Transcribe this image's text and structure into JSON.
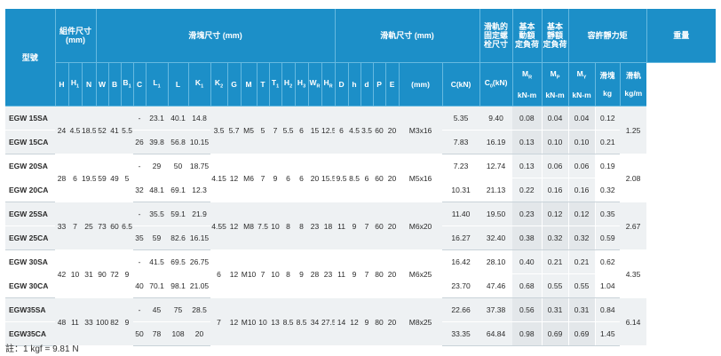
{
  "header": {
    "model": "型號",
    "assembly_dims": "組件尺寸",
    "assembly_unit": "(mm)",
    "block_dims": "滑塊尺寸 (mm)",
    "rail_dims": "滑軌尺寸 (mm)",
    "rail_bolt_line1": "滑軌的",
    "rail_bolt_line2": "固定螺",
    "rail_bolt_line3": "栓尺寸",
    "dyn_line1": "基本",
    "dyn_line2": "動額",
    "dyn_line3": "定負荷",
    "stat_line1": "基本",
    "stat_line2": "靜額",
    "stat_line3": "定負荷",
    "static_moment": "容許靜力矩",
    "weight": "重量",
    "sub": {
      "H": "H",
      "H1": "H",
      "H1_sub": "1",
      "N": "N",
      "W": "W",
      "B": "B",
      "B1": "B",
      "B1_sub": "1",
      "C": "C",
      "L1": "L",
      "L1_sub": "1",
      "L": "L",
      "K1": "K",
      "K1_sub": "1",
      "K2": "K",
      "K2_sub": "2",
      "G": "G",
      "M": "M",
      "T": "T",
      "T1": "T",
      "T1_sub": "1",
      "H2": "H",
      "H2_sub": "2",
      "H3": "H",
      "H3_sub": "3",
      "WR": "W",
      "WR_sub": "R",
      "HR": "H",
      "HR_sub": "R",
      "D": "D",
      "h": "h",
      "d": "d",
      "P": "P",
      "E": "E",
      "bolt_unit": "(mm)",
      "C_unit": "C(kN)",
      "C0": "C",
      "C0_sub": "0",
      "C0_unit": "(kN)",
      "MR": "M",
      "MR_sub": "R",
      "MR_unit": "kN-m",
      "MP": "M",
      "MP_sub": "P",
      "MP_unit": "kN-m",
      "MY": "M",
      "MY_sub": "Y",
      "MY_unit": "kN-m",
      "block_w": "滑塊",
      "block_w_unit": "kg",
      "rail_w": "滑軌",
      "rail_w_unit": "kg/m"
    }
  },
  "groups": [
    {
      "models": [
        "EGW 15SA",
        "EGW 15CA"
      ],
      "H": "24",
      "H1": "4.5",
      "N": "18.5",
      "W": "52",
      "B": "41",
      "B1": "5.5",
      "C": [
        "-",
        "26"
      ],
      "L1": [
        "23.1",
        "39.8"
      ],
      "L": [
        "40.1",
        "56.8"
      ],
      "K1": [
        "14.8",
        "10.15"
      ],
      "K2": "3.5",
      "G": "5.7",
      "M": "M5",
      "T": "5",
      "T1": "7",
      "H2": "5.5",
      "H3": "6",
      "WR": "15",
      "HR": "12.5",
      "D": "6",
      "h": "4.5",
      "d": "3.5",
      "P": "60",
      "E": "20",
      "bolt": "M3x16",
      "Cdyn": [
        "5.35",
        "7.83"
      ],
      "C0": [
        "9.40",
        "16.19"
      ],
      "MR": [
        "0.08",
        "0.13"
      ],
      "MP": [
        "0.04",
        "0.10"
      ],
      "MY": [
        "0.04",
        "0.10"
      ],
      "block_w": [
        "0.12",
        "0.21"
      ],
      "rail_w": "1.25"
    },
    {
      "models": [
        "EGW 20SA",
        "EGW 20CA"
      ],
      "H": "28",
      "H1": "6",
      "N": "19.5",
      "W": "59",
      "B": "49",
      "B1": "5",
      "C": [
        "-",
        "32"
      ],
      "L1": [
        "29",
        "48.1"
      ],
      "L": [
        "50",
        "69.1"
      ],
      "K1": [
        "18.75",
        "12.3"
      ],
      "K2": "4.15",
      "G": "12",
      "M": "M6",
      "T": "7",
      "T1": "9",
      "H2": "6",
      "H3": "6",
      "WR": "20",
      "HR": "15.5",
      "D": "9.5",
      "h": "8.5",
      "d": "6",
      "P": "60",
      "E": "20",
      "bolt": "M5x16",
      "Cdyn": [
        "7.23",
        "10.31"
      ],
      "C0": [
        "12.74",
        "21.13"
      ],
      "MR": [
        "0.13",
        "0.22"
      ],
      "MP": [
        "0.06",
        "0.16"
      ],
      "MY": [
        "0.06",
        "0.16"
      ],
      "block_w": [
        "0.19",
        "0.32"
      ],
      "rail_w": "2.08"
    },
    {
      "models": [
        "EGW 25SA",
        "EGW 25CA"
      ],
      "H": "33",
      "H1": "7",
      "N": "25",
      "W": "73",
      "B": "60",
      "B1": "6.5",
      "C": [
        "-",
        "35"
      ],
      "L1": [
        "35.5",
        "59"
      ],
      "L": [
        "59.1",
        "82.6"
      ],
      "K1": [
        "21.9",
        "16.15"
      ],
      "K2": "4.55",
      "G": "12",
      "M": "M8",
      "T": "7.5",
      "T1": "10",
      "H2": "8",
      "H3": "8",
      "WR": "23",
      "HR": "18",
      "D": "11",
      "h": "9",
      "d": "7",
      "P": "60",
      "E": "20",
      "bolt": "M6x20",
      "Cdyn": [
        "11.40",
        "16.27"
      ],
      "C0": [
        "19.50",
        "32.40"
      ],
      "MR": [
        "0.23",
        "0.38"
      ],
      "MP": [
        "0.12",
        "0.32"
      ],
      "MY": [
        "0.12",
        "0.32"
      ],
      "block_w": [
        "0.35",
        "0.59"
      ],
      "rail_w": "2.67"
    },
    {
      "models": [
        "EGW 30SA",
        "EGW 30CA"
      ],
      "H": "42",
      "H1": "10",
      "N": "31",
      "W": "90",
      "B": "72",
      "B1": "9",
      "C": [
        "-",
        "40"
      ],
      "L1": [
        "41.5",
        "70.1"
      ],
      "L": [
        "69.5",
        "98.1"
      ],
      "K1": [
        "26.75",
        "21.05"
      ],
      "K2": "6",
      "G": "12",
      "M": "M10",
      "T": "7",
      "T1": "10",
      "H2": "8",
      "H3": "9",
      "WR": "28",
      "HR": "23",
      "D": "11",
      "h": "9",
      "d": "7",
      "P": "80",
      "E": "20",
      "bolt": "M6x25",
      "Cdyn": [
        "16.42",
        "23.70"
      ],
      "C0": [
        "28.10",
        "47.46"
      ],
      "MR": [
        "0.40",
        "0.68"
      ],
      "MP": [
        "0.21",
        "0.55"
      ],
      "MY": [
        "0.21",
        "0.55"
      ],
      "block_w": [
        "0.62",
        "1.04"
      ],
      "rail_w": "4.35"
    },
    {
      "models": [
        "EGW35SA",
        "EGW35CA"
      ],
      "H": "48",
      "H1": "11",
      "N": "33",
      "W": "100",
      "B": "82",
      "B1": "9",
      "C": [
        "-",
        "50"
      ],
      "L1": [
        "45",
        "78"
      ],
      "L": [
        "75",
        "108"
      ],
      "K1": [
        "28.5",
        "20"
      ],
      "K2": "7",
      "G": "12",
      "M": "M10",
      "T": "10",
      "T1": "13",
      "H2": "8.5",
      "H3": "8.5",
      "WR": "34",
      "HR": "27.5",
      "D": "14",
      "h": "12",
      "d": "9",
      "P": "80",
      "E": "20",
      "bolt": "M8x25",
      "Cdyn": [
        "22.66",
        "33.35"
      ],
      "C0": [
        "37.38",
        "64.84"
      ],
      "MR": [
        "0.56",
        "0.98"
      ],
      "MP": [
        "0.31",
        "0.69"
      ],
      "MY": [
        "0.31",
        "0.69"
      ],
      "block_w": [
        "0.84",
        "1.45"
      ],
      "rail_w": "6.14"
    }
  ],
  "footnote": "註：1 kgf = 9.81 N"
}
